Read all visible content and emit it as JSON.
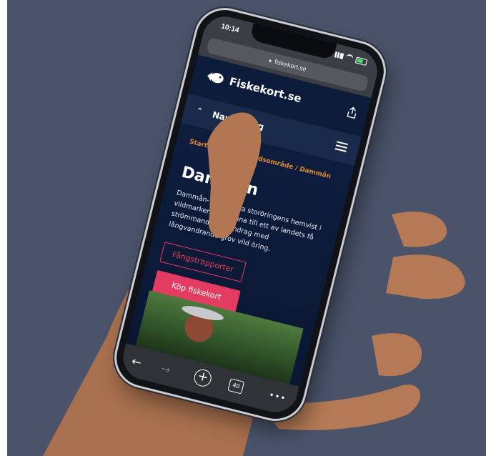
{
  "status_bar": {
    "time": "10:14"
  },
  "browser": {
    "url": "fiskekort.se"
  },
  "site": {
    "name": "Fiskekort.se"
  },
  "nav": {
    "label": "Navigering"
  },
  "breadcrumb": {
    "items": [
      "Startsida",
      "Fiskevårdsområde",
      "Dammån"
    ],
    "separator": " / "
  },
  "page": {
    "title": "Dammån",
    "intro": "Dammån- Den grova storöringens hemvist i vildmarken. Välkomna till ett av landets få strömmande vattendrag med långvandrande grov vild öring."
  },
  "buttons": {
    "catch_reports": "Fångstrapporter",
    "buy_license": "Köp fiskekort"
  },
  "toolbar": {
    "tabs_count": "40"
  },
  "icons": {
    "logo": "fish-icon",
    "share": "share-icon",
    "menu": "hamburger-icon",
    "nav_toggle": "chevron-up-icon",
    "back": "arrow-left-icon",
    "forward": "arrow-right-icon",
    "new_tab": "plus-icon",
    "tabs": "tabs-icon",
    "more": "more-icon"
  },
  "colors": {
    "accent": "#e43b62",
    "breadcrumb": "#e08a2a",
    "header": "#0d1c3b",
    "background": "#4a536a"
  }
}
